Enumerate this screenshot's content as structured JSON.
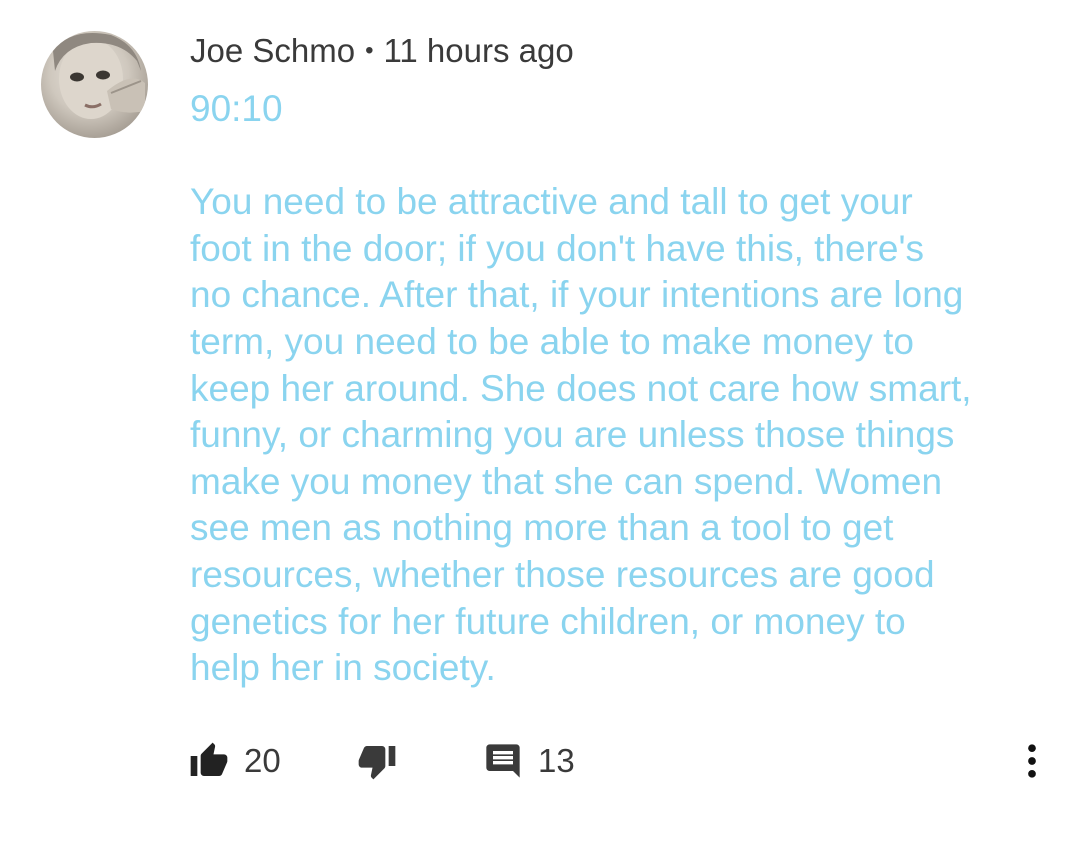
{
  "comment": {
    "author": "Joe Schmo",
    "separator": "•",
    "time": "11 hours ago",
    "avatar_icon": "user-avatar-photo",
    "text_color": "#8ad4ef",
    "lines": [
      "90:10",
      "",
      "You need to be attractive and tall to get your",
      "foot in the door; if you don't have this, there's",
      "no chance. After that, if your intentions are long",
      "term, you need to be able to make money to",
      "keep her around. She does not care how smart,",
      "funny, or charming you are unless those things",
      "make you money that she can spend. Women",
      "see men as nothing more than a tool to get",
      "resources, whether those resources are good",
      "genetics for her future children, or money to",
      "help her in society."
    ],
    "actions": {
      "like_icon": "thumbs-up-icon",
      "like_count": "20",
      "dislike_icon": "thumbs-down-icon",
      "reply_icon": "comment-icon",
      "reply_count": "13",
      "more_icon": "more-vert-icon"
    }
  }
}
